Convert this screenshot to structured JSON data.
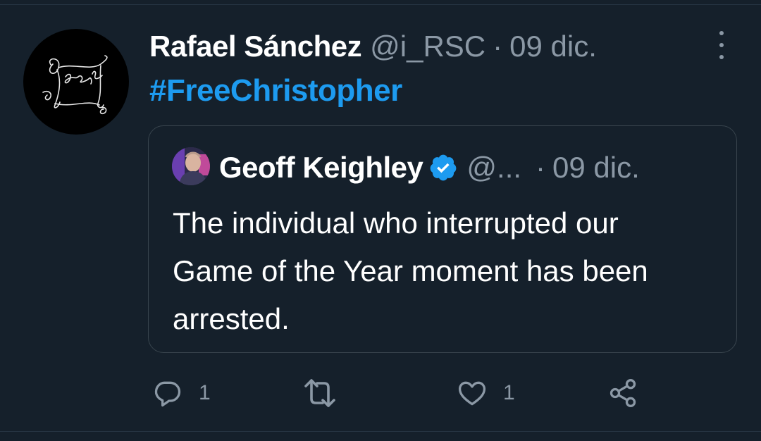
{
  "tweet": {
    "author_name": "Rafael Sánchez",
    "author_handle": "@i_RSC",
    "separator": "·",
    "date": "09 dic.",
    "text": "#FreeChristopher"
  },
  "quoted_tweet": {
    "author_name": "Geoff Keighley",
    "author_handle": "@...",
    "separator": "·",
    "date": "09 dic.",
    "text": "The individual who interrupted our Game of the Year moment has been arrested."
  },
  "actions": {
    "reply_count": "1",
    "like_count": "1"
  },
  "icons": [
    "more-icon",
    "verified-icon",
    "reply-icon",
    "retweet-icon",
    "like-icon",
    "share-icon"
  ],
  "colors": {
    "background": "#15202b",
    "accent": "#1d9bf0",
    "secondary_text": "#8b98a5",
    "border": "#38444d"
  }
}
